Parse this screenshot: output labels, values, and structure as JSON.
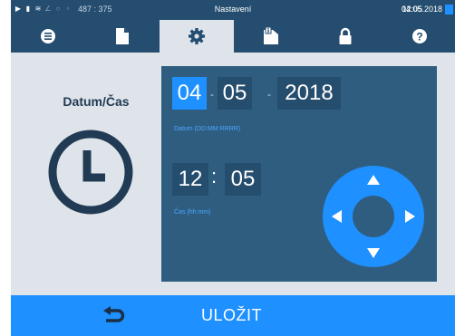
{
  "status_bar": {
    "counter": "487 : 375",
    "title": "Nastavení",
    "time": "12:05",
    "date": "04.05.2018"
  },
  "tabs": [
    {
      "icon": "list-icon"
    },
    {
      "icon": "document-icon"
    },
    {
      "icon": "gear-icon",
      "active": true
    },
    {
      "icon": "info-document-icon"
    },
    {
      "icon": "lock-icon"
    },
    {
      "icon": "help-icon"
    }
  ],
  "side": {
    "title": "Datum/Čas",
    "icon": "clock-icon"
  },
  "date": {
    "day": "04",
    "month": "05",
    "year": "2018",
    "separator": "-",
    "caption": "Datum (DD:MM:RRRR)"
  },
  "time": {
    "hours": "12",
    "minutes": "05",
    "separator": ":",
    "caption": "Čas (hh:mm)"
  },
  "bottom": {
    "save_label": "ULOŽIT"
  },
  "colors": {
    "status_bar": "#244d6f",
    "accent": "#1e90ff",
    "panel": "#2f5d80",
    "field": "#254d6e",
    "background": "#dfe4ea"
  }
}
